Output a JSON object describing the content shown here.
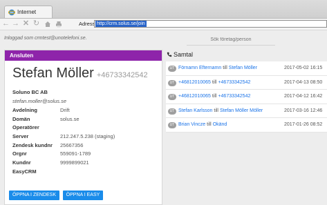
{
  "browser": {
    "tab_label": "Internet",
    "address_label": "Adress",
    "url": "http://crm.solus.se/join"
  },
  "page": {
    "logged_in_text": "Inloggad som crmtest@unotelefoni.se.",
    "search_placeholder": "Sök företag/person"
  },
  "contact": {
    "header": "Ansluten",
    "name": "Stefan Möller",
    "phone": "+46733342542",
    "company": "Soluno BC AB",
    "email": "stefan.moller@solus.se",
    "fields": [
      {
        "label": "Avdelning",
        "value": "Drift"
      },
      {
        "label": "Domän",
        "value": "solus.se"
      },
      {
        "label": "Operatörer",
        "value": ""
      },
      {
        "label": "Server",
        "value": "212.247.5.238 (staging)"
      },
      {
        "label": "Zendesk kundnr",
        "value": "25667356"
      },
      {
        "label": "Orgnr",
        "value": "559091-1789"
      },
      {
        "label": "Kundnr",
        "value": "9999899021"
      },
      {
        "label": "EasyCRM",
        "value": ""
      }
    ],
    "buttons": {
      "zendesk": "ÖPPNA I ZENDESK",
      "easy": "ÖPPNA I EASY"
    }
  },
  "calls": {
    "title": "Samtal",
    "connector": "till",
    "items": [
      {
        "badge": "UT",
        "from": "Förnamn Efternamn",
        "to": "Stefan Möller",
        "date": "2017-05-02 16:15"
      },
      {
        "badge": "UT",
        "from": "+46812010065",
        "to": "+46733342542",
        "date": "2017-04-13 08:50"
      },
      {
        "badge": "UT",
        "from": "+46812010065",
        "to": "+46733342542",
        "date": "2017-04-12 16:42"
      },
      {
        "badge": "UT",
        "from": "Stefan Karlsson",
        "to": "Stefan Möller Möller",
        "date": "2017-03-16 12:46"
      },
      {
        "badge": "UT",
        "from": "Brian Vincze",
        "to": "Okänd",
        "date": "2017-01-26 08:52"
      }
    ]
  },
  "colors": {
    "header_purple": "#8e24aa",
    "button_blue": "#1a8cea",
    "link_blue": "#1a73e8"
  }
}
